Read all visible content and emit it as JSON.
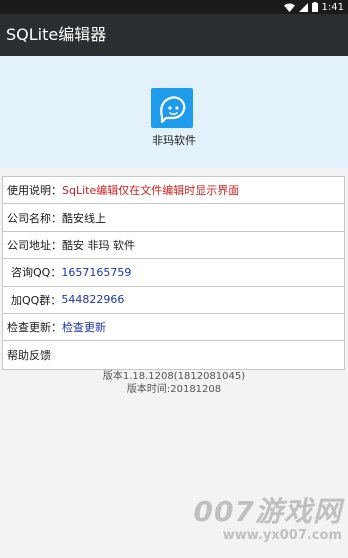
{
  "status_bar": {
    "time": "1:41"
  },
  "app_bar": {
    "title": "SQLite编辑器"
  },
  "header": {
    "app_name": "非玛软件",
    "logo_icon": "smiling-face-icon"
  },
  "info_rows": [
    {
      "label": "使用说明：",
      "value": "SqLite编辑仅在文件编辑时显示界面",
      "value_color": "#d42020"
    },
    {
      "label": "公司名称：",
      "value": "酷安线上",
      "value_color": "#1a1a1a"
    },
    {
      "label": "公司地址：",
      "value": "酷安 非玛 软件",
      "value_color": "#1a1a1a"
    },
    {
      "label": "咨询QQ：",
      "value": "1657165759",
      "value_color": "#1a35a8"
    },
    {
      "label": "加QQ群：",
      "value": "544822966",
      "value_color": "#1a35a8"
    },
    {
      "label": "检查更新：",
      "value": "检查更新",
      "value_color": "#1a35a8"
    },
    {
      "label": "帮助反馈",
      "value": "",
      "value_color": "#1a1a1a"
    }
  ],
  "version": {
    "version_line": "版本1.18.1208(1812081045)",
    "time_line": "版本时间:20181208"
  },
  "watermark": {
    "main": "007游戏网",
    "sub": "www.yx007.com"
  },
  "colors": {
    "status_bar": "#1b1b1b",
    "app_bar": "#2b2e30",
    "header_bg": "#e3f1fb",
    "logo_bg": "#1f9bec",
    "accent_red": "#d42020",
    "link_blue": "#1a35a8"
  }
}
